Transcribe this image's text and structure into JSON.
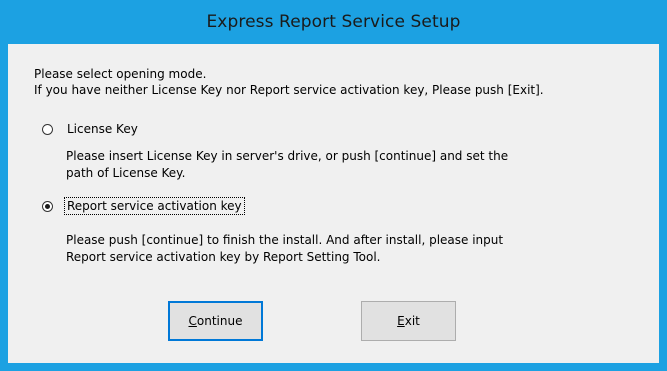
{
  "window": {
    "title": "Express Report Service Setup"
  },
  "intro": {
    "line1": "Please select opening mode.",
    "line2": "If you have neither License Key nor Report service activation key, Please push [Exit]."
  },
  "options": [
    {
      "label": "License Key",
      "selected": false,
      "description_line1": "Please insert License Key in server's drive, or push [continue] and set the",
      "description_line2": "path of License Key."
    },
    {
      "label": "Report service activation key",
      "selected": true,
      "description_line1": "Please push [continue] to finish the install. And after install, please input",
      "description_line2": "Report service activation key by Report Setting Tool."
    }
  ],
  "buttons": {
    "continue_label": "Continue",
    "exit_label": "Exit"
  },
  "colors": {
    "titlebar": "#1ca1e2",
    "client_background": "#f0f0f0",
    "button_face": "#e1e1e1",
    "default_button_border": "#0078d7"
  }
}
